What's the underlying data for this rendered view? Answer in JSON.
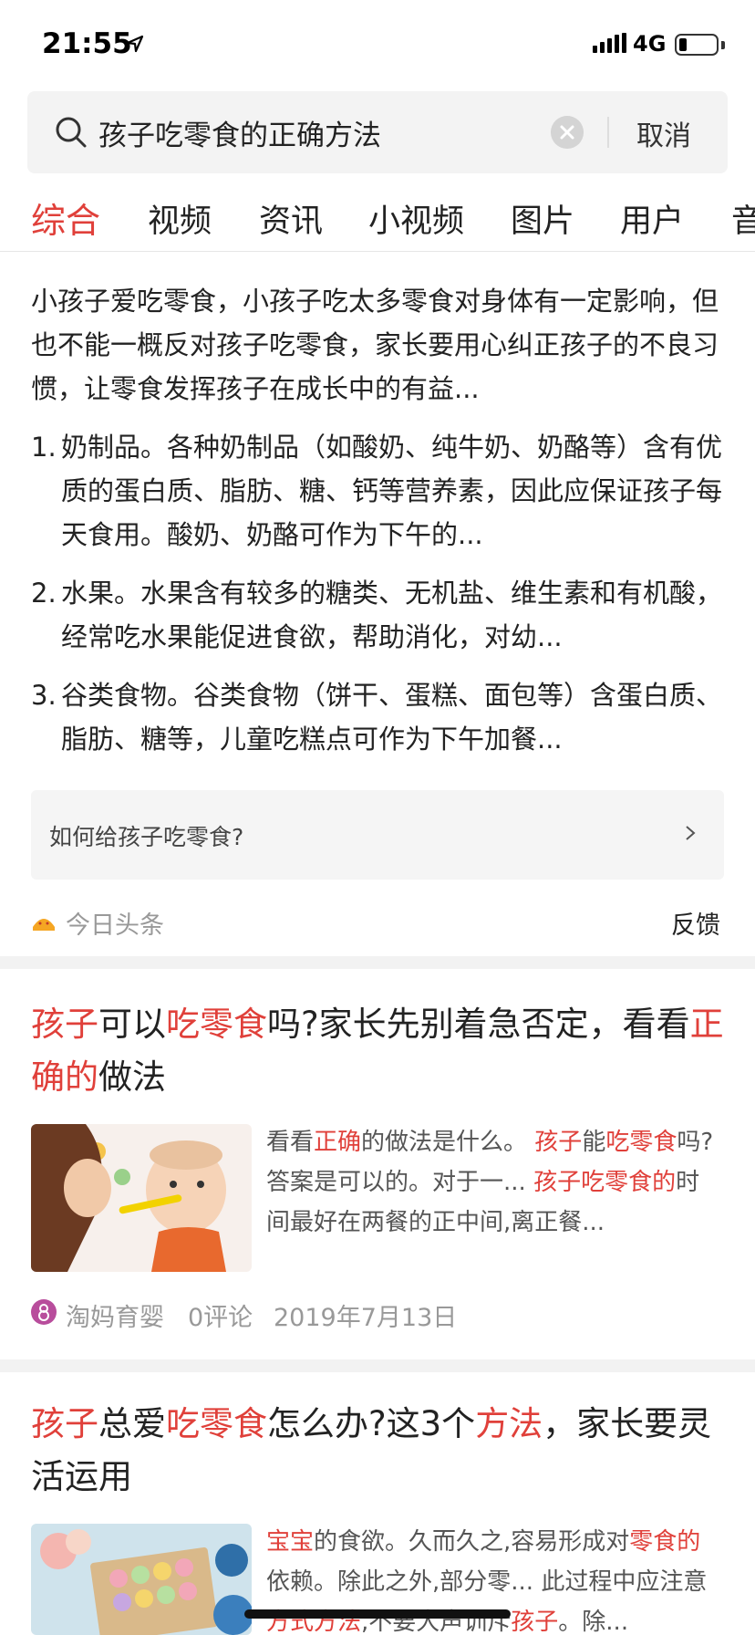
{
  "status_bar": {
    "time": "21:55",
    "network": "4G"
  },
  "search": {
    "query": "孩子吃零食的正确方法",
    "cancel_label": "取消"
  },
  "tabs": [
    {
      "label": "综合",
      "active": true
    },
    {
      "label": "视频",
      "active": false
    },
    {
      "label": "资讯",
      "active": false
    },
    {
      "label": "小视频",
      "active": false
    },
    {
      "label": "图片",
      "active": false
    },
    {
      "label": "用户",
      "active": false
    },
    {
      "label": "音",
      "active": false
    }
  ],
  "answer": {
    "intro": "小孩子爱吃零食，小孩子吃太多零食对身体有一定影响，但也不能一概反对孩子吃零食，家长要用心纠正孩子的不良习惯，让零食发挥孩子在成长中的有益...",
    "items": [
      {
        "num": "1.",
        "text": "奶制品。各种奶制品（如酸奶、纯牛奶、奶酪等）含有优质的蛋白质、脂肪、糖、钙等营养素，因此应保证孩子每天食用。酸奶、奶酪可作为下午的..."
      },
      {
        "num": "2.",
        "text": "水果。水果含有较多的糖类、无机盐、维生素和有机酸，经常吃水果能促进食欲，帮助消化，对幼..."
      },
      {
        "num": "3.",
        "text": "谷类食物。谷类食物（饼干、蛋糕、面包等）含蛋白质、脂肪、糖等，儿童吃糕点可作为下午加餐..."
      }
    ],
    "related_question": "如何给孩子吃零食?",
    "source": "今日头条",
    "feedback_label": "反馈"
  },
  "results": [
    {
      "title_parts": [
        {
          "text": "孩子",
          "hl": true
        },
        {
          "text": "可以",
          "hl": false
        },
        {
          "text": "吃零食",
          "hl": true
        },
        {
          "text": "吗?家长先别着急否定，看看",
          "hl": false
        },
        {
          "text": "正确的",
          "hl": true
        },
        {
          "text": "做法",
          "hl": false
        }
      ],
      "snippet_parts": [
        {
          "text": "看看",
          "hl": false
        },
        {
          "text": "正确",
          "hl": true
        },
        {
          "text": "的做法是什么。 ",
          "hl": false
        },
        {
          "text": "孩子",
          "hl": true
        },
        {
          "text": "能",
          "hl": false
        },
        {
          "text": "吃零食",
          "hl": true
        },
        {
          "text": "吗? 答案是可以的。对于一... ",
          "hl": false
        },
        {
          "text": "孩子吃零食的",
          "hl": true
        },
        {
          "text": "时间最好在两餐的正中间,离正餐...",
          "hl": false
        }
      ],
      "source": "淘妈育婴",
      "comments": "0评论",
      "date": "2019年7月13日"
    },
    {
      "title_parts": [
        {
          "text": "孩子",
          "hl": true
        },
        {
          "text": "总爱",
          "hl": false
        },
        {
          "text": "吃零食",
          "hl": true
        },
        {
          "text": "怎么办?这3个",
          "hl": false
        },
        {
          "text": "方法",
          "hl": true
        },
        {
          "text": "，家长要灵活运用",
          "hl": false
        }
      ],
      "snippet_parts": [
        {
          "text": "宝宝",
          "hl": true
        },
        {
          "text": "的食欲。久而久之,容易形成对",
          "hl": false
        },
        {
          "text": "零食的",
          "hl": true
        },
        {
          "text": "依赖。除此之外,部分零... 此过程中应注意",
          "hl": false
        },
        {
          "text": "方式方法",
          "hl": true
        },
        {
          "text": ",不要大声训斥",
          "hl": false
        },
        {
          "text": "孩子",
          "hl": true
        },
        {
          "text": "。除...",
          "hl": false
        }
      ]
    }
  ],
  "colors": {
    "accent": "#e0403a",
    "muted": "#999999",
    "separator": "#f2f2f2"
  },
  "icons": [
    "location-arrow-icon",
    "signal-icon",
    "battery-icon",
    "search-icon",
    "clear-icon",
    "chevron-right-icon",
    "toutiao-icon",
    "taoma-icon"
  ]
}
